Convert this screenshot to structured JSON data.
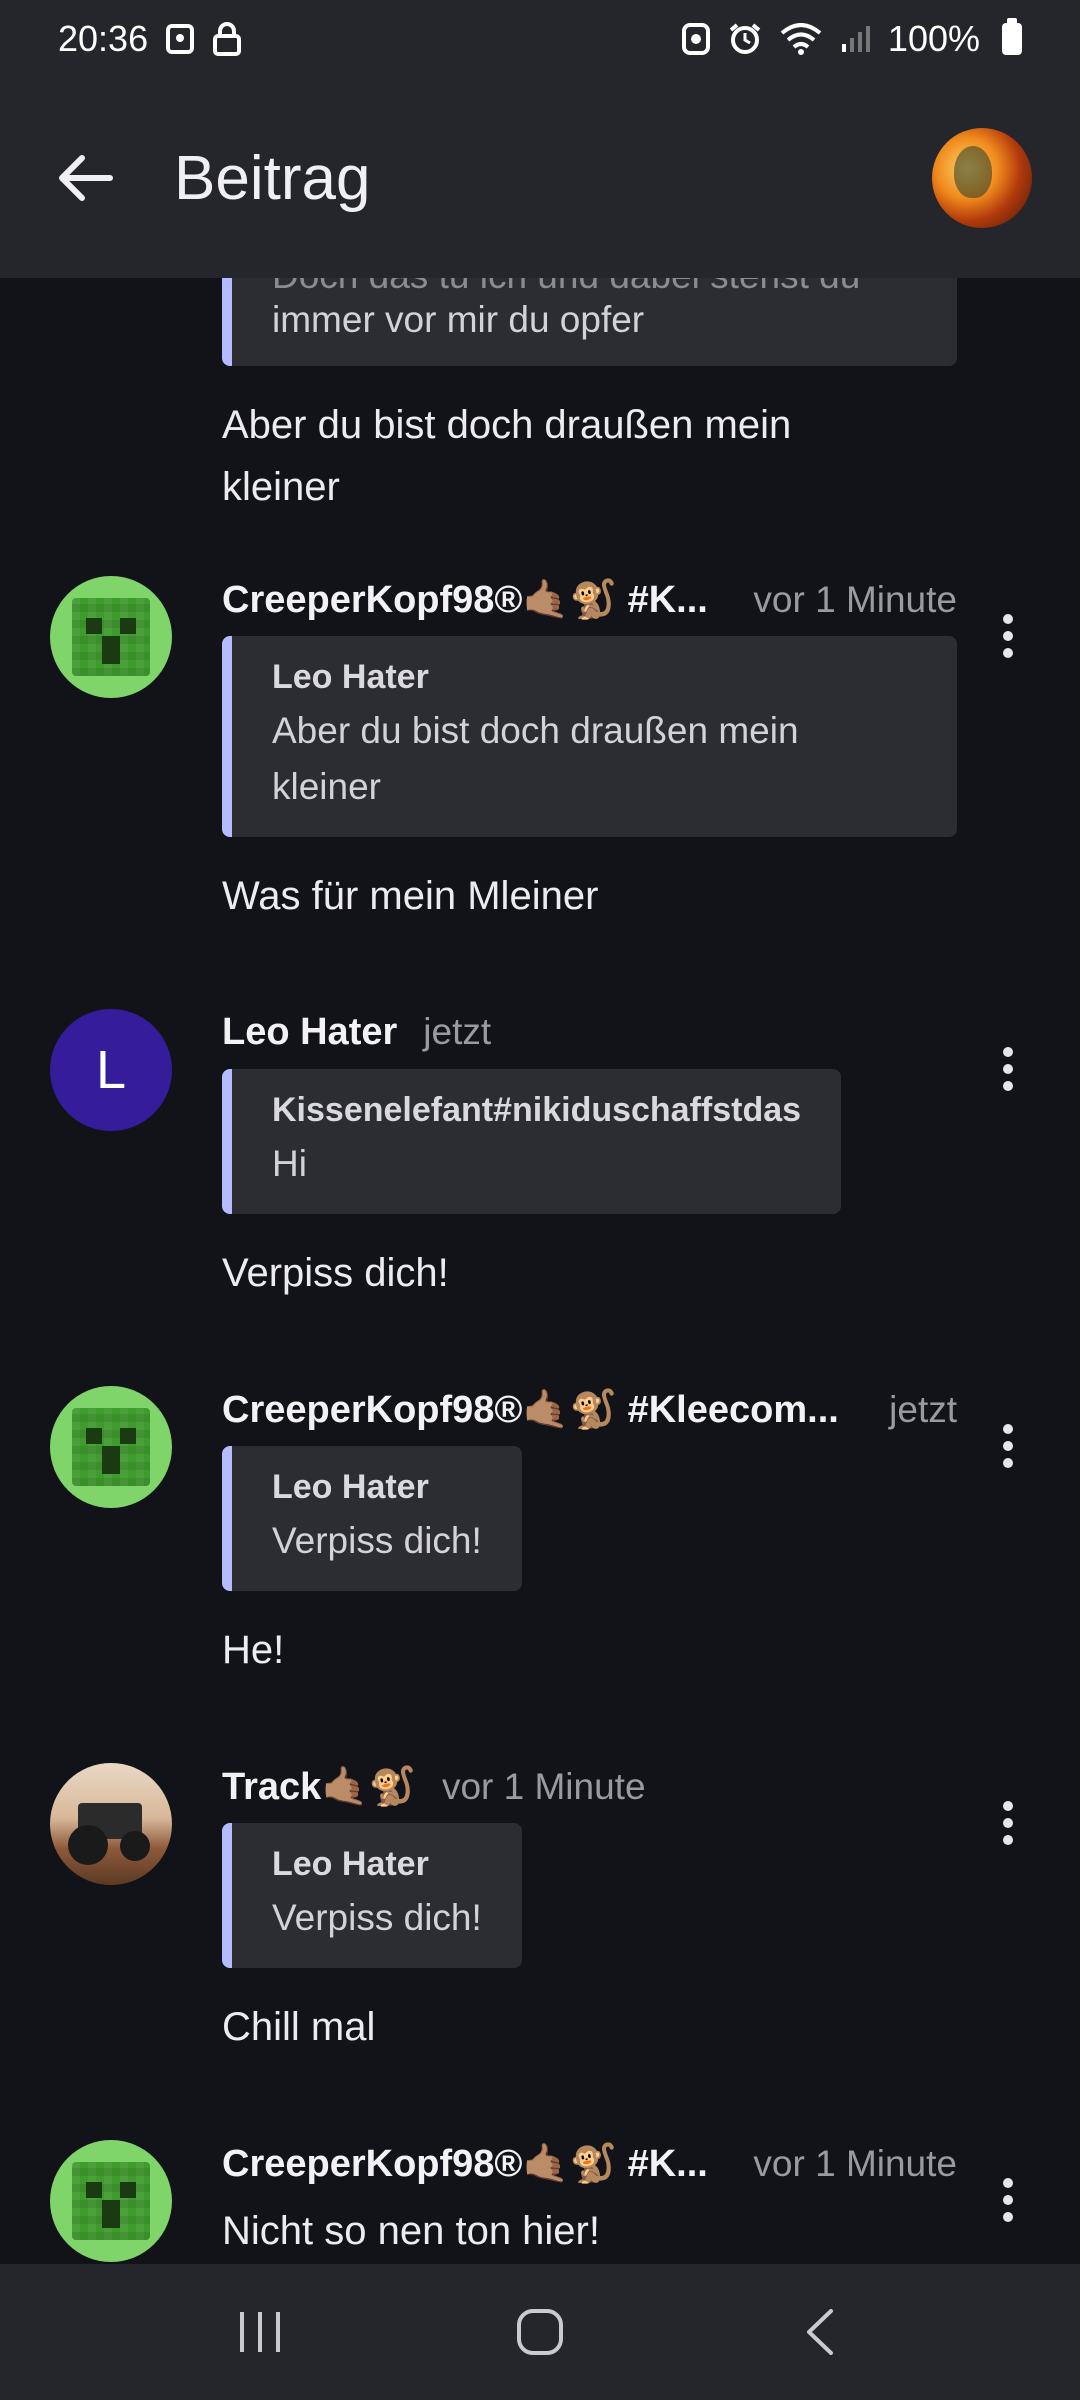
{
  "status_bar": {
    "time": "20:36",
    "battery": "100%"
  },
  "header": {
    "title": "Beitrag"
  },
  "top_partial": {
    "quote_text": "immer vor mir du opfer",
    "quote_cut_text": "Doch das tu ich und dabei stehst du",
    "message": "Aber du bist doch draußen mein kleiner"
  },
  "messages": [
    {
      "author": "CreeperKopf98®🤙🏽🐒 #K...",
      "time": "vor 1 Minute",
      "quote_author": "Leo Hater",
      "quote_text": "Aber du bist doch draußen mein kleiner",
      "text": "Was für mein Mleiner"
    },
    {
      "author": "Leo Hater",
      "avatar_letter": "L",
      "time": "jetzt",
      "quote_author": "Kissenelefant#nikiduschaffstdas",
      "quote_text": "Hi",
      "text": "Verpiss dich!"
    },
    {
      "author": "CreeperKopf98®🤙🏽🐒 #Kleecom...",
      "time": "jetzt",
      "quote_author": "Leo Hater",
      "quote_text": "Verpiss dich!",
      "text": "He!"
    },
    {
      "author": "Track🤙🏽🐒",
      "time": "vor 1 Minute",
      "quote_author": "Leo Hater",
      "quote_text": "Verpiss dich!",
      "text": "Chill mal"
    },
    {
      "author": "CreeperKopf98®🤙🏽🐒 #K...",
      "time": "vor 1 Minute",
      "text": "Nicht so nen ton hier!"
    }
  ],
  "nav": {
    "recents": "recents-icon",
    "home": "home-icon",
    "back": "back-icon"
  },
  "colors": {
    "background": "#121318",
    "bar": "#25262b",
    "quote_accent": "#b4bcff",
    "leo_avatar": "#341c9a"
  }
}
